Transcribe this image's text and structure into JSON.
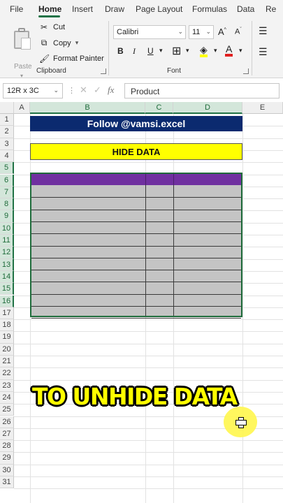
{
  "ribbon_tabs": [
    "File",
    "Home",
    "Insert",
    "Draw",
    "Page Layout",
    "Formulas",
    "Data",
    "Re"
  ],
  "clipboard": {
    "paste": "Paste",
    "cut": "Cut",
    "copy": "Copy",
    "format_painter": "Format Painter",
    "label": "Clipboard"
  },
  "font": {
    "name": "Calibri",
    "size": "11",
    "grow": "A",
    "shrink": "A",
    "bold": "B",
    "italic": "I",
    "underline": "U",
    "font_color_letter": "A",
    "label": "Font"
  },
  "formula_bar": {
    "name_box": "12R x 3C",
    "fx": "fx",
    "content": "Product"
  },
  "columns": [
    "A",
    "B",
    "C",
    "D",
    "E"
  ],
  "rows": [
    "1",
    "2",
    "3",
    "4",
    "5",
    "6",
    "7",
    "8",
    "9",
    "10",
    "11",
    "12",
    "13",
    "14",
    "15",
    "16",
    "17",
    "18",
    "19",
    "20",
    "21",
    "22",
    "23",
    "24",
    "25",
    "26",
    "27",
    "28",
    "29",
    "30",
    "31"
  ],
  "sheet": {
    "follow_banner": "Follow @vamsi.excel",
    "hide_banner": "HIDE DATA"
  },
  "overlay_caption": "TO UNHIDE DATA",
  "colors": {
    "accent": "#217346",
    "banner_blue": "#0b2a6f",
    "banner_yellow": "#ffff00",
    "table_header": "#7030a0",
    "hidden_fill": "#c4c4c4"
  }
}
